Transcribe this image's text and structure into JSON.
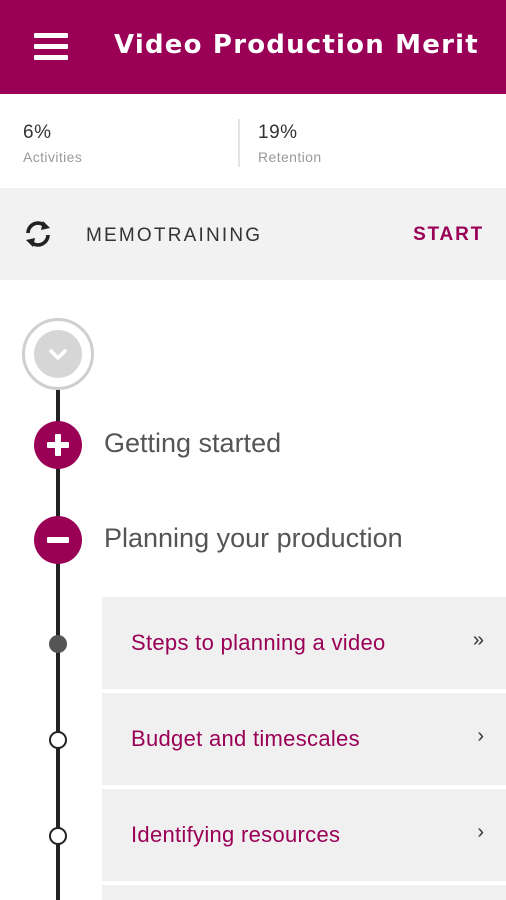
{
  "app": {
    "title": "Video Production Merit"
  },
  "stats": [
    {
      "value": "6%",
      "label": "Activities"
    },
    {
      "value": "19%",
      "label": "Retention"
    }
  ],
  "memotraining": {
    "label": "MEMOTRAINING",
    "action": "START"
  },
  "sections": [
    {
      "label": "Getting started",
      "state": "collapsed"
    },
    {
      "label": "Planning your production",
      "state": "expanded"
    }
  ],
  "lessons": [
    {
      "title": "Steps to planning a video",
      "arrow": "»",
      "status": "current"
    },
    {
      "title": "Budget and timescales",
      "arrow": "›",
      "status": "not-started"
    },
    {
      "title": "Identifying resources",
      "arrow": "›",
      "status": "not-started"
    }
  ],
  "colors": {
    "brand": "#990056",
    "panel": "#f0f0f0"
  }
}
